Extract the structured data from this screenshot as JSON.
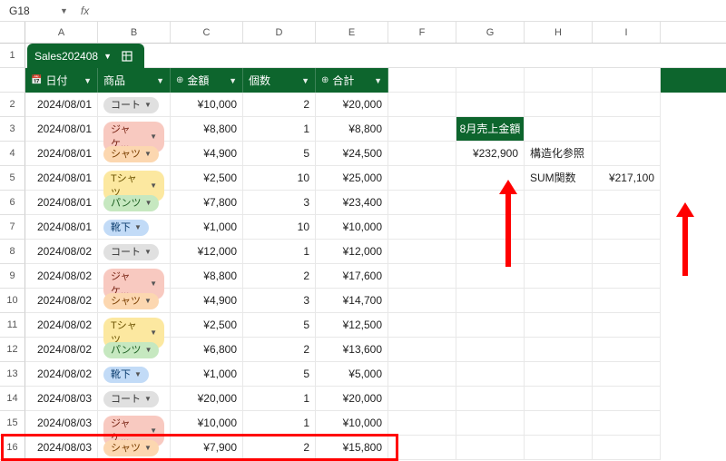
{
  "namebox": {
    "value": "G18",
    "fx": "fx"
  },
  "columns": [
    "A",
    "B",
    "C",
    "D",
    "E",
    "F",
    "G",
    "H",
    "I"
  ],
  "table": {
    "name": "Sales202408",
    "headers": {
      "date": "日付",
      "product": "商品",
      "amount": "金額",
      "qty": "個数",
      "total": "合計"
    },
    "rows": [
      {
        "n": 2,
        "date": "2024/08/01",
        "product": "コート",
        "pill": "p-gray",
        "amount": "¥10,000",
        "qty": "2",
        "total": "¥20,000"
      },
      {
        "n": 3,
        "date": "2024/08/01",
        "product": "ジャケ...",
        "pill": "p-red",
        "amount": "¥8,800",
        "qty": "1",
        "total": "¥8,800"
      },
      {
        "n": 4,
        "date": "2024/08/01",
        "product": "シャツ",
        "pill": "p-orange",
        "amount": "¥4,900",
        "qty": "5",
        "total": "¥24,500"
      },
      {
        "n": 5,
        "date": "2024/08/01",
        "product": "Tシャツ",
        "pill": "p-yellow",
        "amount": "¥2,500",
        "qty": "10",
        "total": "¥25,000"
      },
      {
        "n": 6,
        "date": "2024/08/01",
        "product": "パンツ",
        "pill": "p-green",
        "amount": "¥7,800",
        "qty": "3",
        "total": "¥23,400"
      },
      {
        "n": 7,
        "date": "2024/08/01",
        "product": "靴下",
        "pill": "p-blue",
        "amount": "¥1,000",
        "qty": "10",
        "total": "¥10,000"
      },
      {
        "n": 8,
        "date": "2024/08/02",
        "product": "コート",
        "pill": "p-gray",
        "amount": "¥12,000",
        "qty": "1",
        "total": "¥12,000"
      },
      {
        "n": 9,
        "date": "2024/08/02",
        "product": "ジャケ...",
        "pill": "p-red",
        "amount": "¥8,800",
        "qty": "2",
        "total": "¥17,600"
      },
      {
        "n": 10,
        "date": "2024/08/02",
        "product": "シャツ",
        "pill": "p-orange",
        "amount": "¥4,900",
        "qty": "3",
        "total": "¥14,700"
      },
      {
        "n": 11,
        "date": "2024/08/02",
        "product": "Tシャツ",
        "pill": "p-yellow",
        "amount": "¥2,500",
        "qty": "5",
        "total": "¥12,500"
      },
      {
        "n": 12,
        "date": "2024/08/02",
        "product": "パンツ",
        "pill": "p-green",
        "amount": "¥6,800",
        "qty": "2",
        "total": "¥13,600"
      },
      {
        "n": 13,
        "date": "2024/08/02",
        "product": "靴下",
        "pill": "p-blue",
        "amount": "¥1,000",
        "qty": "5",
        "total": "¥5,000"
      },
      {
        "n": 14,
        "date": "2024/08/03",
        "product": "コート",
        "pill": "p-gray",
        "amount": "¥20,000",
        "qty": "1",
        "total": "¥20,000"
      },
      {
        "n": 15,
        "date": "2024/08/03",
        "product": "ジャケ...",
        "pill": "p-red",
        "amount": "¥10,000",
        "qty": "1",
        "total": "¥10,000"
      },
      {
        "n": 16,
        "date": "2024/08/03",
        "product": "シャツ",
        "pill": "p-orange",
        "amount": "¥7,900",
        "qty": "2",
        "total": "¥15,800"
      }
    ]
  },
  "side": {
    "title": "8月売上金額",
    "struct_value": "¥232,900",
    "struct_label": "構造化参照",
    "sum_label": "SUM関数",
    "sum_value": "¥217,100"
  }
}
